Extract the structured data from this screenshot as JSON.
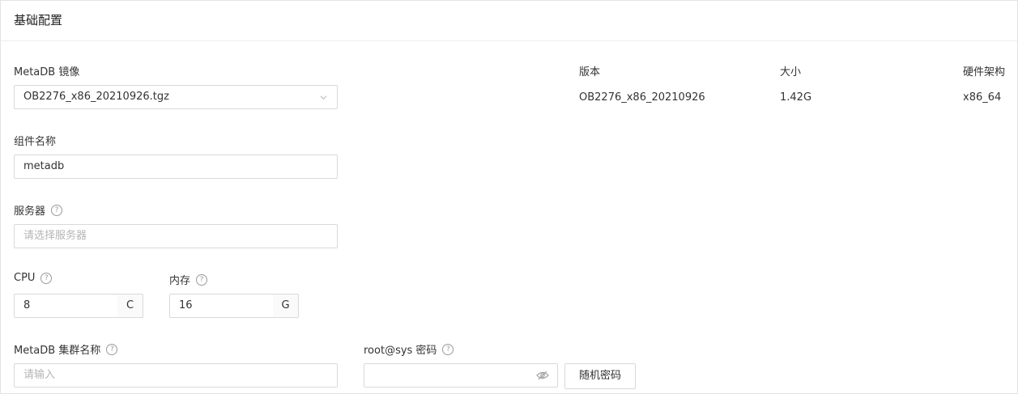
{
  "section": {
    "title": "基础配置"
  },
  "metadb_image": {
    "label": "MetaDB 镜像",
    "value": "OB2276_x86_20210926.tgz",
    "icon": "chevron-down-icon"
  },
  "image_info": {
    "version_header": "版本",
    "size_header": "大小",
    "arch_header": "硬件架构",
    "version_value": "OB2276_x86_20210926",
    "size_value": "1.42G",
    "arch_value": "x86_64"
  },
  "component_name": {
    "label": "组件名称",
    "value": "metadb"
  },
  "servers": {
    "label": "服务器",
    "placeholder": "请选择服务器",
    "help_icon": "question-circle-icon"
  },
  "cpu": {
    "label": "CPU",
    "value": "8",
    "unit": "C",
    "help_icon": "question-circle-icon"
  },
  "memory": {
    "label": "内存",
    "value": "16",
    "unit": "G",
    "help_icon": "question-circle-icon"
  },
  "cluster_name": {
    "label": "MetaDB 集群名称",
    "placeholder": "请输入",
    "help_icon": "question-circle-icon"
  },
  "root_password": {
    "label": "root@sys 密码",
    "value": "",
    "icon": "eye-invisible-icon",
    "random_button": "随机密码",
    "help_icon": "question-circle-icon"
  }
}
